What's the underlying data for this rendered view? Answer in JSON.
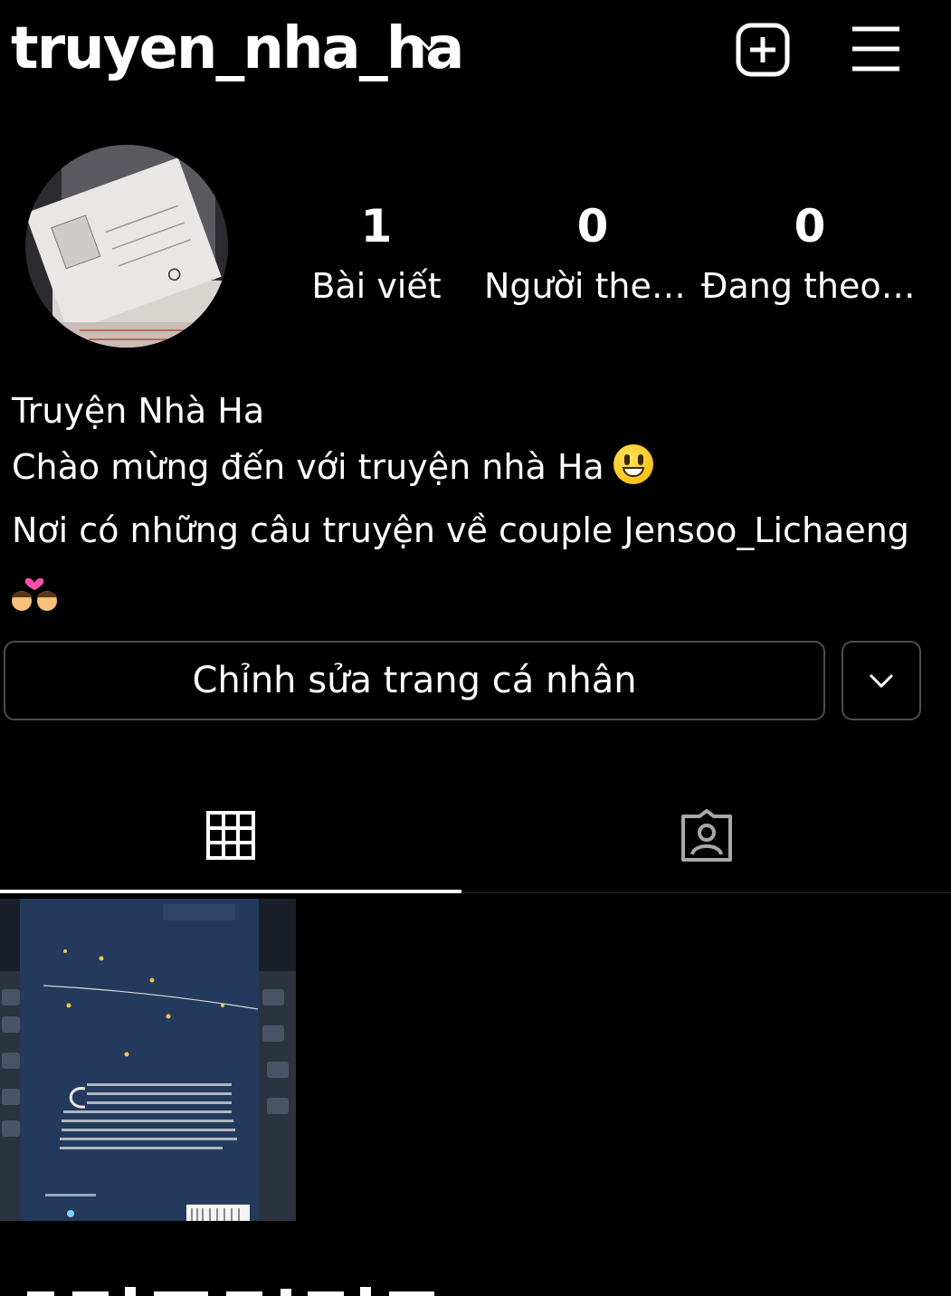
{
  "header": {
    "username": "truyen_nha_ha",
    "icons": [
      "chevron-down-icon",
      "add-post-icon",
      "menu-icon"
    ]
  },
  "stats": {
    "posts": {
      "count": "1",
      "label": "Bài viết"
    },
    "followers": {
      "count": "0",
      "label": "Người theo dõi"
    },
    "following": {
      "count": "0",
      "label": "Đang theo dõi"
    }
  },
  "bio": {
    "name": "Truyện Nhà Ha",
    "line1": "Chào mừng đến với truyện nhà Ha",
    "line2": "Nơi có những câu truyện về couple Jensoo_Lichaeng",
    "emojis": [
      "grinning-face",
      "couple-with-heart"
    ]
  },
  "actions": {
    "edit_profile": "Chỉnh sửa trang cá nhân"
  },
  "tabs": {
    "items": [
      "grid-icon",
      "tagged-icon"
    ],
    "active": "grid-icon"
  },
  "posts": {
    "count": 1
  }
}
